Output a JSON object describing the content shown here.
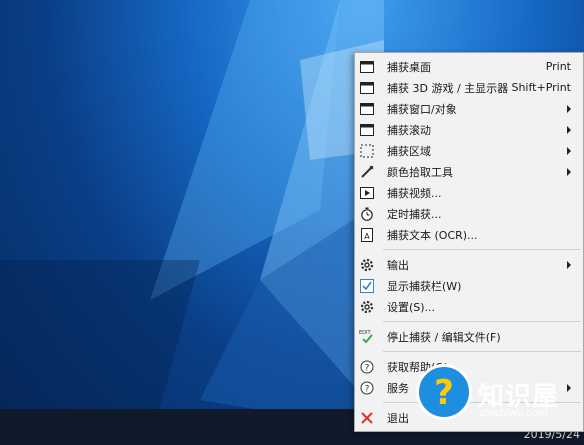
{
  "menu": {
    "items": [
      {
        "icon": "window-icon",
        "label": "捕获桌面",
        "shortcut": "Print"
      },
      {
        "icon": "window-icon",
        "label": "捕获 3D 游戏 / 主显示器",
        "shortcut": "Shift+Print"
      },
      {
        "icon": "window-icon",
        "label": "捕获窗口/对象",
        "submenu": true
      },
      {
        "icon": "window-icon",
        "label": "捕获滚动",
        "submenu": true
      },
      {
        "icon": "dashed-region-icon",
        "label": "捕获区域",
        "submenu": true
      },
      {
        "icon": "eyedropper-icon",
        "label": "颜色拾取工具",
        "submenu": true
      },
      {
        "icon": "video-icon",
        "label": "捕获视频..."
      },
      {
        "icon": "timer-icon",
        "label": "定时捕获..."
      },
      {
        "icon": "text-doc-icon",
        "label": "捕获文本 (OCR)..."
      },
      {
        "icon": "gear-icon",
        "label": "输出",
        "submenu": true
      },
      {
        "icon": "checkbox-checked-icon",
        "label": "显示捕获栏(W)"
      },
      {
        "icon": "gear-icon",
        "label": "设置(S)..."
      },
      {
        "icon": "edit-check-icon",
        "label": "停止捕获 / 编辑文件(F)",
        "icon_text": "EDIT"
      },
      {
        "icon": "help-circle-icon",
        "label": "获取帮助(O)..."
      },
      {
        "icon": "help-circle-icon",
        "label": "服务",
        "submenu": true
      },
      {
        "icon": "close-x-icon",
        "label": "退出"
      }
    ]
  },
  "taskbar": {
    "date": "2019/5/24"
  },
  "watermark": {
    "main": "知识屋",
    "sub": "zhishiwu.com"
  },
  "colors": {
    "menu_bg": "#f2f2f2",
    "accent_blue": "#1e8fe0",
    "exit_red": "#e03030"
  }
}
